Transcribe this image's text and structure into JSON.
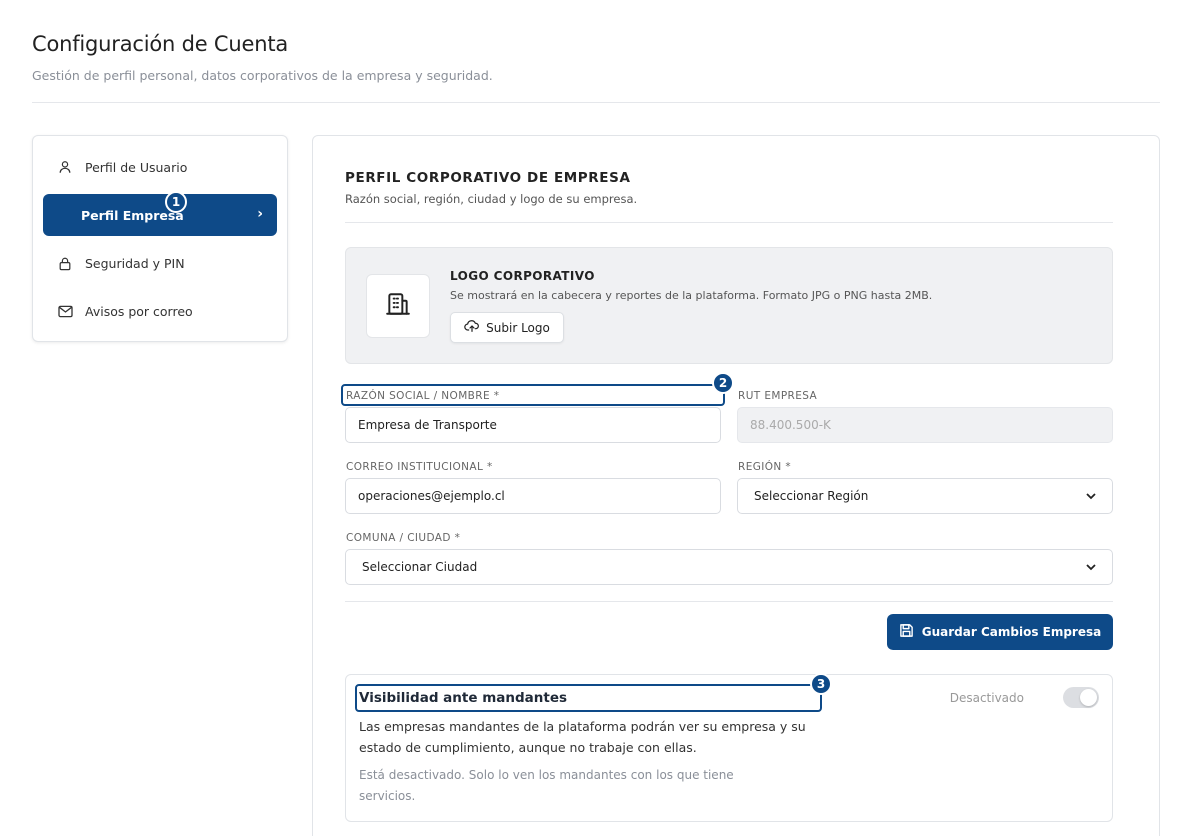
{
  "header": {
    "title": "Configuración de Cuenta",
    "subtitle": "Gestión de perfil personal, datos corporativos de la empresa y seguridad."
  },
  "sidebar": {
    "items": [
      {
        "label": "Perfil de Usuario",
        "icon": "user-icon"
      },
      {
        "label": "Perfil Empresa",
        "icon": "chevron-right-icon",
        "active": true
      },
      {
        "label": "Seguridad y PIN",
        "icon": "lock-icon"
      },
      {
        "label": "Avisos por correo",
        "icon": "mail-icon"
      }
    ]
  },
  "badges": {
    "b1": "1",
    "b2": "2",
    "b3": "3"
  },
  "section": {
    "title": "PERFIL CORPORATIVO DE EMPRESA",
    "subtitle": "Razón social, región, ciudad y logo de su empresa."
  },
  "logo": {
    "title": "LOGO CORPORATIVO",
    "description": "Se mostrará en la cabecera y reportes de la plataforma. Formato JPG o PNG hasta 2MB.",
    "upload_label": "Subir Logo"
  },
  "form": {
    "razon_label": "RAZÓN SOCIAL / NOMBRE *",
    "razon_value": "Empresa de Transporte",
    "rut_label": "RUT EMPRESA",
    "rut_value": "88.400.500-K",
    "correo_label": "CORREO INSTITUCIONAL *",
    "correo_value": "operaciones@ejemplo.cl",
    "region_label": "REGIÓN *",
    "region_value": "Seleccionar Región",
    "comuna_label": "COMUNA / CIUDAD *",
    "comuna_value": "Seleccionar Ciudad",
    "save_label": "Guardar Cambios Empresa"
  },
  "visibility": {
    "title": "Visibilidad ante mandantes",
    "description": "Las empresas mandantes de la plataforma podrán ver su empresa y su estado de cumplimiento, aunque no trabaje con ellas.",
    "note": "Está desactivado. Solo lo ven los mandantes con los que tiene servicios.",
    "status": "Desactivado",
    "enabled": false
  },
  "colors": {
    "accent": "#0e4a88"
  }
}
